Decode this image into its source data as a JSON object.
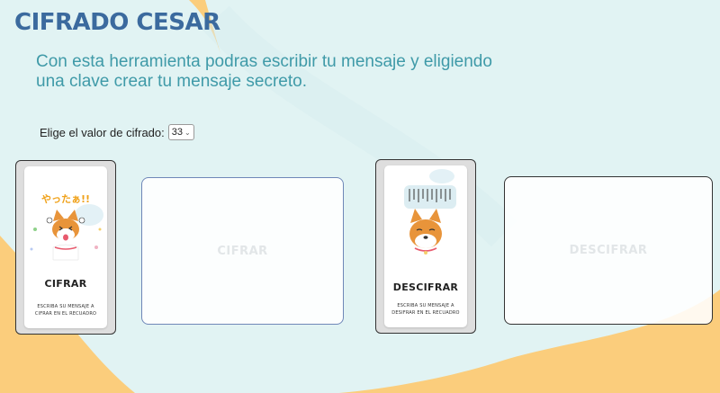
{
  "header": {
    "title": "CIFRADO CESAR"
  },
  "intro": {
    "text": "Con esta herramienta podras escribir tu mensaje y eligiendo una clave crear tu mensaje secreto."
  },
  "shift": {
    "label": "Elige el valor de cifrado:",
    "selected": "33"
  },
  "encrypt": {
    "sticker_text": "やったぁ!!",
    "title": "CIFRAR",
    "instruction": "ESCRIBA SU MENSAJE A CIFRAR EN EL RECUADRO",
    "placeholder": "CIFRAR"
  },
  "decrypt": {
    "title": "DESCIFRAR",
    "instruction": "ESCRIBA SU MENSAJE A DESIFRAR EN EL RECUADRO",
    "placeholder": "DESCIFRAR"
  },
  "colors": {
    "background": "#fbcd7c",
    "wave": "#e1f3f3",
    "title": "#3b6a9e",
    "intro": "#3f9aa8"
  },
  "icons": [
    "happy-shiba-icon",
    "sad-shiba-icon",
    "chevron-down-icon"
  ]
}
